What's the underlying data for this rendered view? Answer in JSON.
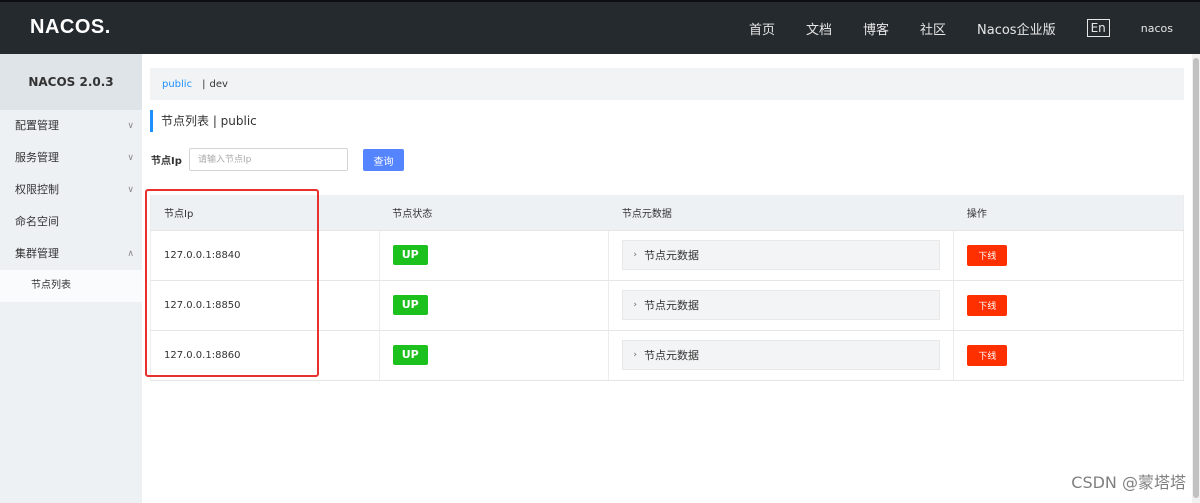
{
  "header": {
    "logo": "NACOS.",
    "nav": [
      "首页",
      "文档",
      "博客",
      "社区",
      "Nacos企业版"
    ],
    "lang": "En",
    "user": "nacos"
  },
  "sidebar": {
    "title": "NACOS 2.0.3",
    "items": [
      {
        "label": "配置管理",
        "chevron": "down"
      },
      {
        "label": "服务管理",
        "chevron": "down"
      },
      {
        "label": "权限控制",
        "chevron": "down"
      },
      {
        "label": "命名空间",
        "chevron": ""
      },
      {
        "label": "集群管理",
        "chevron": "up"
      }
    ],
    "sub_items": [
      "节点列表"
    ]
  },
  "namespace": {
    "active": "public",
    "separator": "|",
    "other": "dev"
  },
  "page": {
    "title": "节点列表 | public"
  },
  "search": {
    "label": "节点Ip",
    "placeholder": "请输入节点Ip",
    "button": "查询"
  },
  "table": {
    "columns": [
      "节点Ip",
      "节点状态",
      "节点元数据",
      "操作"
    ],
    "rows": [
      {
        "ip": "127.0.0.1:8840",
        "status": "UP",
        "meta": "节点元数据",
        "action": "下线"
      },
      {
        "ip": "127.0.0.1:8850",
        "status": "UP",
        "meta": "节点元数据",
        "action": "下线"
      },
      {
        "ip": "127.0.0.1:8860",
        "status": "UP",
        "meta": "节点元数据",
        "action": "下线"
      }
    ]
  },
  "watermark": "CSDN @蒙塔塔",
  "colors": {
    "topbar": "#252a2f",
    "accent": "#1e90ff",
    "search_button": "#5584ff",
    "status_up": "#1dc11d",
    "offline_button": "#ff3000",
    "highlight": "#e8312f"
  }
}
